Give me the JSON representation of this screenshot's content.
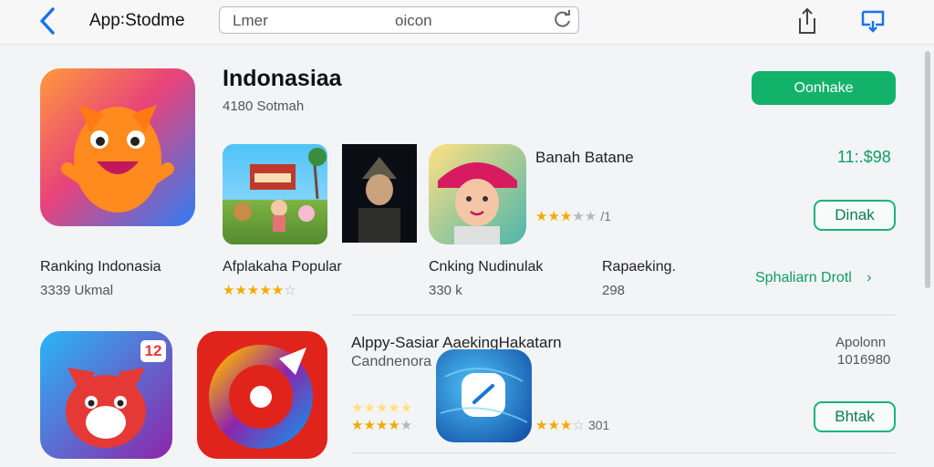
{
  "header": {
    "app_title": "App꞉Stodme",
    "search_placeholder": "Lmer",
    "search_middle": "oicon"
  },
  "featured": {
    "title": "Indonasiaa",
    "subtitle": "4180 Sotmah",
    "primary_button": "Oonhake"
  },
  "featured_item": {
    "name": "Banah Batane",
    "price": "11:.$98",
    "button": "Dinak",
    "rating": 3
  },
  "row1": [
    {
      "title": "Ranking Indonasia",
      "meta": "3339 Ukmal"
    },
    {
      "title": "Afplakaha Popular",
      "rating": 4
    },
    {
      "title": "Cnking Nudinulak",
      "meta": "330 k"
    },
    {
      "title": "Rapaeking.",
      "meta": "298"
    }
  ],
  "see_all": "Sphaliarn Drotl",
  "row2": {
    "title": "Alppy-Sasiar AaekingHakatarn",
    "subtitle": "Candnenora",
    "right_top": "Apolonn",
    "right_sub": "1016980",
    "button": "Bhtak",
    "stars_a": 5,
    "stars_b": 4,
    "stars_c_label": "301",
    "stars_c": 3,
    "badge": "12"
  }
}
